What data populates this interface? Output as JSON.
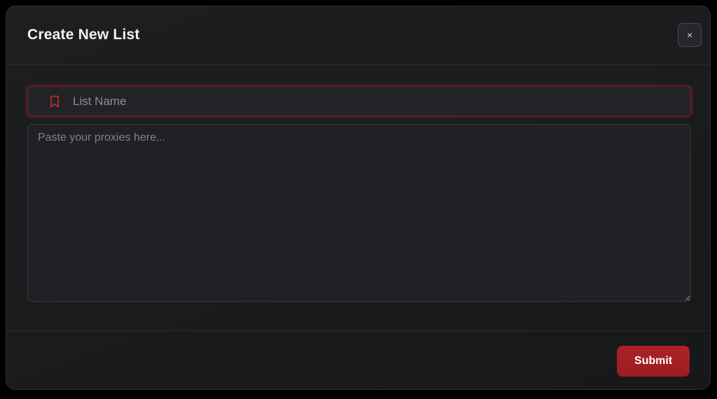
{
  "dialog": {
    "title": "Create New List",
    "close_label": "×"
  },
  "form": {
    "list_name": {
      "value": "",
      "placeholder": "List Name",
      "icon": "bookmark-icon"
    },
    "proxies": {
      "value": "",
      "placeholder": "Paste your proxies here..."
    }
  },
  "footer": {
    "submit_label": "Submit"
  },
  "colors": {
    "accent": "#a61f24",
    "background": "#1b1c1e",
    "text": "#f2f2f2"
  }
}
